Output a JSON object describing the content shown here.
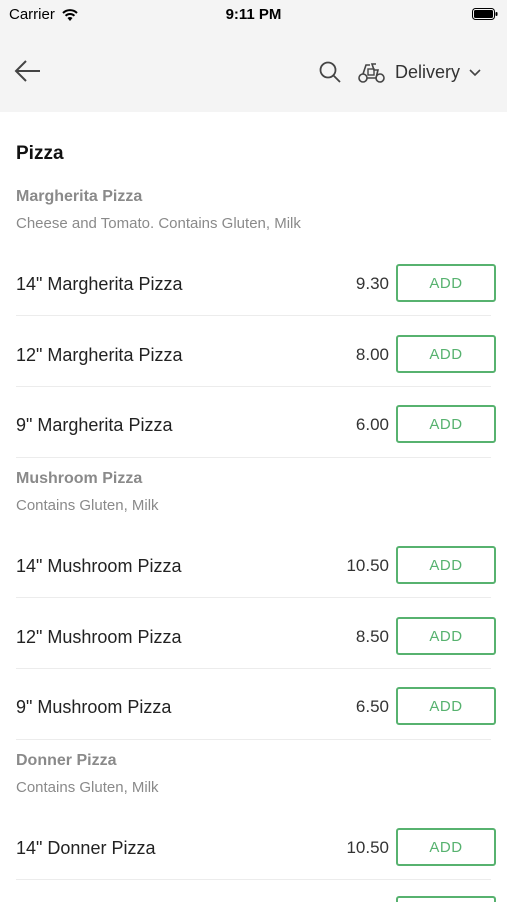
{
  "status_bar": {
    "carrier": "Carrier",
    "time": "9:11 PM"
  },
  "header": {
    "delivery_label": "Delivery"
  },
  "menu": {
    "section_title": "Pizza",
    "groups": [
      {
        "title": "Margherita Pizza",
        "description": "Cheese and Tomato. Contains Gluten, Milk",
        "items": [
          {
            "name": "14\" Margherita Pizza",
            "price": "9.30",
            "add_label": "ADD"
          },
          {
            "name": "12\" Margherita Pizza",
            "price": "8.00",
            "add_label": "ADD"
          },
          {
            "name": "9\" Margherita Pizza",
            "price": "6.00",
            "add_label": "ADD"
          }
        ]
      },
      {
        "title": "Mushroom Pizza",
        "description": "Contains Gluten, Milk",
        "items": [
          {
            "name": "14\" Mushroom Pizza",
            "price": "10.50",
            "add_label": "ADD"
          },
          {
            "name": "12\" Mushroom Pizza",
            "price": "8.50",
            "add_label": "ADD"
          },
          {
            "name": "9\" Mushroom Pizza",
            "price": "6.50",
            "add_label": "ADD"
          }
        ]
      },
      {
        "title": "Donner Pizza",
        "description": "Contains Gluten, Milk",
        "items": [
          {
            "name": "14\" Donner Pizza",
            "price": "10.50",
            "add_label": "ADD"
          }
        ]
      }
    ]
  },
  "colors": {
    "accent": "#57b26f",
    "header_bg": "#f4f4f4",
    "muted_text": "#8a8a8a"
  },
  "icons": [
    "wifi-icon",
    "battery-icon",
    "back-arrow-icon",
    "search-icon",
    "scooter-icon",
    "chevron-down-icon"
  ]
}
